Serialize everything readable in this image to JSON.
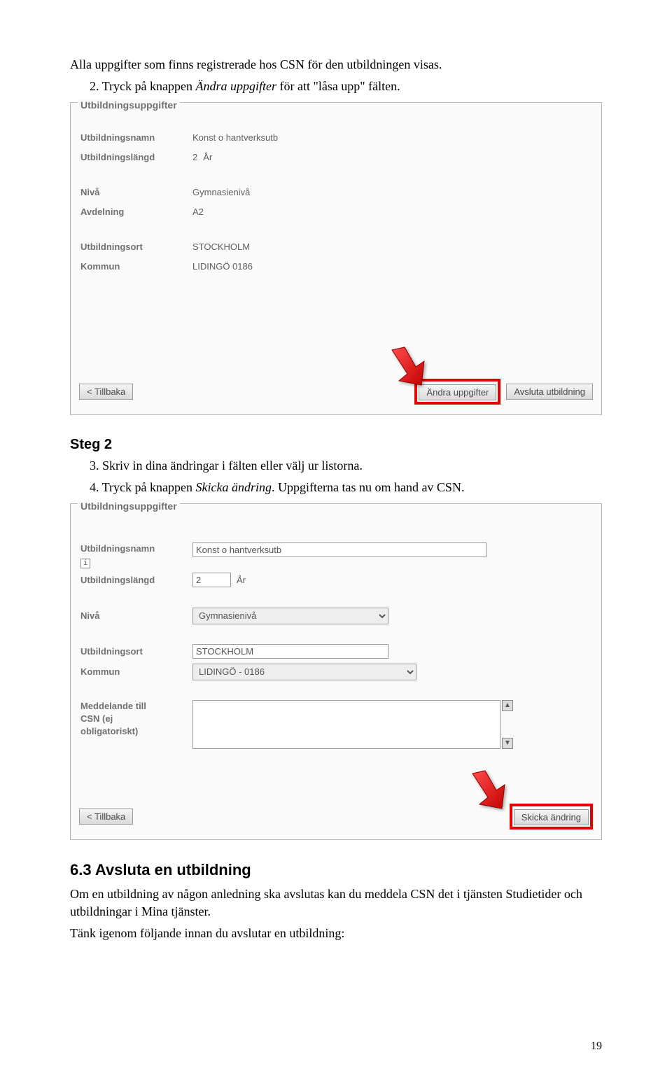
{
  "intro": {
    "line1": "Alla uppgifter som finns registrerade hos CSN för den utbildningen visas.",
    "line2_prefix": "2.   Tryck på knappen ",
    "line2_italic": "Ändra uppgifter",
    "line2_suffix": " för att \"låsa upp\" fälten."
  },
  "shot1": {
    "legend": "Utbildningsuppgifter",
    "rows": [
      {
        "label": "Utbildningsnamn",
        "value": "Konst o hantverksutb"
      },
      {
        "label": "Utbildningslängd",
        "value": "2",
        "unit": "År"
      },
      {
        "label": "Nivå",
        "value": "Gymnasienivå"
      },
      {
        "label": "Avdelning",
        "value": "A2"
      },
      {
        "label": "Utbildningsort",
        "value": "STOCKHOLM"
      },
      {
        "label": "Kommun",
        "value": "LIDINGÖ  0186"
      }
    ],
    "back": "<  Tillbaka",
    "edit": "Ändra uppgifter",
    "end": "Avsluta utbildning"
  },
  "step2": {
    "heading": "Steg 2",
    "line3": "3.   Skriv in dina ändringar i fälten eller välj ur listorna.",
    "line4_prefix": "4.   Tryck på knappen ",
    "line4_italic": "Skicka ändring",
    "line4_suffix": ". Uppgifterna tas nu om hand av CSN."
  },
  "shot2": {
    "legend": "Utbildningsuppgifter",
    "name_label": "Utbildningsnamn",
    "name_value": "Konst o hantverksutb",
    "length_label": "Utbildningslängd",
    "length_value": "2",
    "length_unit": "År",
    "level_label": "Nivå",
    "level_value": "Gymnasienivå",
    "ort_label": "Utbildningsort",
    "ort_value": "STOCKHOLM",
    "kommun_label": "Kommun",
    "kommun_value": "LIDINGÖ - 0186",
    "msg_label_1": "Meddelande till",
    "msg_label_2": "CSN (ej",
    "msg_label_3": "obligatoriskt)",
    "back": "<  Tillbaka",
    "send": "Skicka ändring"
  },
  "section63": {
    "heading": "6.3  Avsluta en utbildning",
    "p": "Om en utbildning av någon anledning ska avslutas kan du meddela CSN det i tjänsten Studietider och utbildningar i Mina tjänster.",
    "p2": "Tänk igenom följande innan du avslutar en utbildning:"
  },
  "pagenum": "19"
}
